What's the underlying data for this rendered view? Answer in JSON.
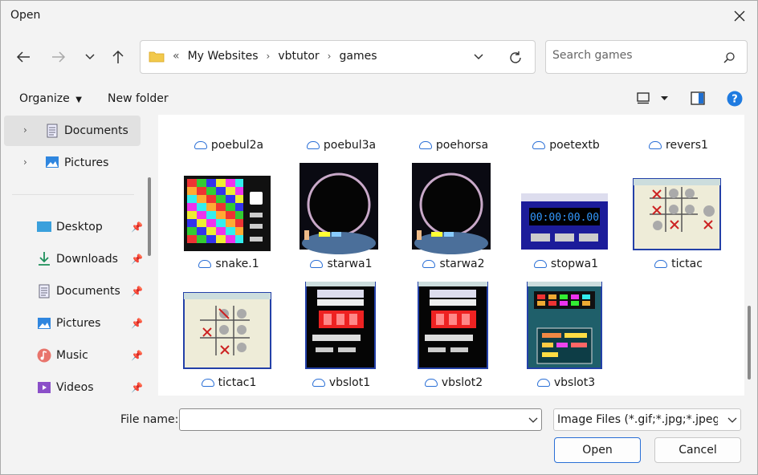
{
  "window": {
    "title": "Open"
  },
  "address": {
    "overflow": "«",
    "crumbs": [
      "My Websites",
      "vbtutor",
      "games"
    ]
  },
  "search": {
    "placeholder": "Search games"
  },
  "toolbar": {
    "organize": "Organize",
    "new_folder": "New folder"
  },
  "sidebar": {
    "items": [
      {
        "label": "Documents",
        "icon": "documents-icon",
        "pinned": false,
        "expand": true
      },
      {
        "label": "Pictures",
        "icon": "pictures-icon",
        "pinned": false,
        "expand": true
      },
      {
        "label": "Desktop",
        "icon": "desktop-icon",
        "pinned": true
      },
      {
        "label": "Downloads",
        "icon": "downloads-icon",
        "pinned": true
      },
      {
        "label": "Documents",
        "icon": "documents-icon",
        "pinned": true
      },
      {
        "label": "Pictures",
        "icon": "pictures-icon",
        "pinned": true
      },
      {
        "label": "Music",
        "icon": "music-icon",
        "pinned": true
      },
      {
        "label": "Videos",
        "icon": "videos-icon",
        "pinned": true
      }
    ]
  },
  "files": [
    {
      "name": "poebul2a"
    },
    {
      "name": "poebul3a"
    },
    {
      "name": "poehorsa"
    },
    {
      "name": "poetextb"
    },
    {
      "name": "revers1"
    },
    {
      "name": "snake.1"
    },
    {
      "name": "starwa1"
    },
    {
      "name": "starwa2"
    },
    {
      "name": "stopwa1"
    },
    {
      "name": "tictac"
    },
    {
      "name": "tictac1"
    },
    {
      "name": "vbslot1"
    },
    {
      "name": "vbslot2"
    },
    {
      "name": "vbslot3"
    }
  ],
  "footer": {
    "file_name_label": "File name:",
    "file_name_value": "",
    "file_type": "Image Files (*.gif;*.jpg;*.jpeg;*.b",
    "open": "Open",
    "cancel": "Cancel"
  }
}
